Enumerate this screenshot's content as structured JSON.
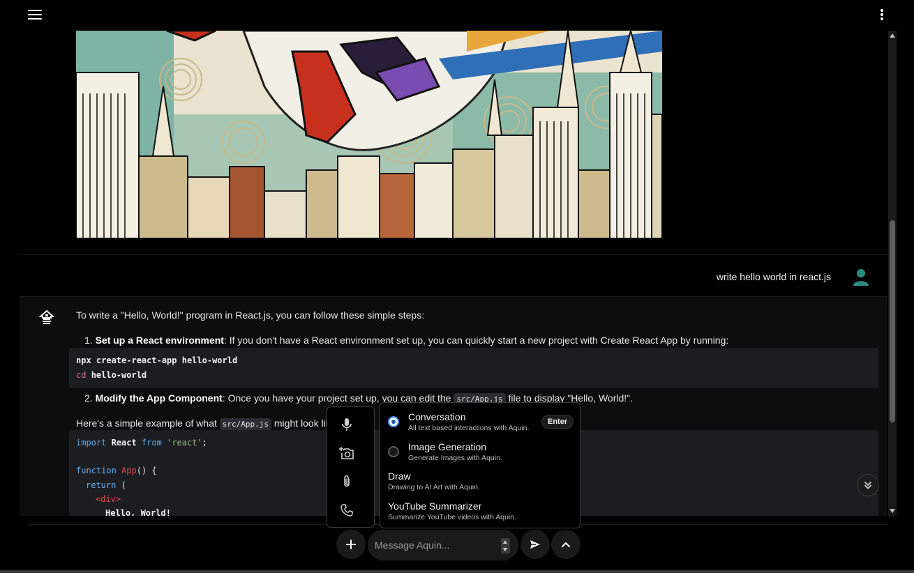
{
  "header": {
    "menu_icon": "hamburger-menu-icon",
    "more_icon": "more-vertical-icon"
  },
  "conversation": {
    "user_message": "write hello world in react.js",
    "bot_response": {
      "intro": "To write a \"Hello, World!\" program in React.js, you can follow these simple steps:",
      "step1_num": "1.",
      "step1_bold": "Set up a React environment",
      "step1_text": ": If you don't have a React environment set up, you can quickly start a new project with Create React App by running:",
      "step1_code": {
        "line1": "npx create-react-app hello-world",
        "line2_cmd": "cd",
        "line2_arg": "hello-world"
      },
      "step2_num": "2.",
      "step2_bold": "Modify the App Component",
      "step2_pre": ": Once you have your project set up, you can edit the ",
      "step2_code": "src/App.js",
      "step2_post": " file to display \"Hello, World!\".",
      "example_pre": "Here's a simple example of what ",
      "example_code": "src/App.js",
      "example_post": " might look lik",
      "code": {
        "l1_import": "import",
        "l1_name": "React",
        "l1_from": "from",
        "l1_str": "'react'",
        "l1_semi": ";",
        "l3_function": "function",
        "l3_name": "App",
        "l3_rest": "() {",
        "l4_return": "return",
        "l4_paren": " (",
        "l5_tag": "<div>",
        "l6_text": "Hello, World!"
      }
    }
  },
  "tools": {
    "items": [
      "microphone-icon",
      "add-photo-icon",
      "attachment-icon",
      "phone-icon"
    ]
  },
  "modes": {
    "selected": "Conversation",
    "items": [
      {
        "title": "Conversation",
        "desc": "All text based interactions with Aquin.",
        "badge": "Enter"
      },
      {
        "title": "Image Generation",
        "desc": "Generate Images with Aquin."
      },
      {
        "title": "Draw",
        "desc": "Drawing to AI Art with Aquin."
      },
      {
        "title": "YouTube Summarizer",
        "desc": "Summarize YouTube videos with Aquin."
      }
    ]
  },
  "composer": {
    "placeholder": "Message Aquin..."
  },
  "colors": {
    "background": "#000000",
    "surface": "#1a1a1a",
    "accent": "#3c8cff",
    "avatar": "#2a8a82"
  }
}
